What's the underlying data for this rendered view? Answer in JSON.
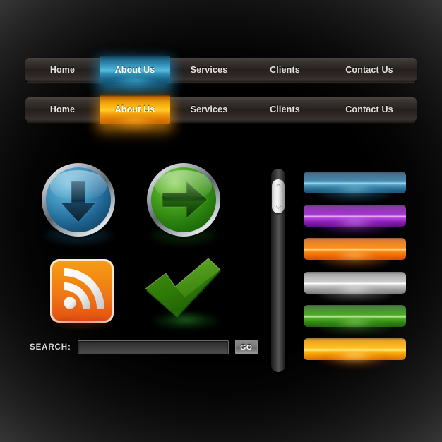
{
  "theme": {
    "background": "#000000",
    "vignette_edge": "#3b3b3b"
  },
  "navbars": [
    {
      "id": "navbar-blue",
      "accent": "#45a7cd",
      "active_index": 1,
      "items": [
        {
          "label": "Home"
        },
        {
          "label": "About Us"
        },
        {
          "label": "Services"
        },
        {
          "label": "Clients"
        },
        {
          "label": "Contact Us"
        }
      ]
    },
    {
      "id": "navbar-orange",
      "accent": "#fcb813",
      "active_index": 1,
      "items": [
        {
          "label": "Home"
        },
        {
          "label": "About Us"
        },
        {
          "label": "Services"
        },
        {
          "label": "Clients"
        },
        {
          "label": "Contact Us"
        }
      ]
    }
  ],
  "icons": {
    "download_button": {
      "name": "download-arrow-button",
      "icon": "arrow-down-icon",
      "color": "#3f92bd",
      "ring": "silver"
    },
    "forward_button": {
      "name": "forward-arrow-button",
      "icon": "arrow-right-icon",
      "color": "#2d8410",
      "ring": "silver"
    },
    "rss_button": {
      "name": "rss-feed-button",
      "icon": "rss-icon",
      "color": "#ee7616"
    },
    "check_button": {
      "name": "checkmark-button",
      "icon": "check-icon",
      "color": "#2d8410"
    }
  },
  "search": {
    "label": "SEARCH:",
    "value": "",
    "placeholder": "",
    "go_label": "GO"
  },
  "scrollbar": {
    "name": "vertical-scrollbar",
    "thumb_position_percent": 3,
    "up_icon": "chevron-up-icon",
    "down_icon": "chevron-down-icon"
  },
  "bar_buttons": [
    {
      "id": "bar-blue",
      "name": "blue-bar-button",
      "color": "#3f88ad"
    },
    {
      "id": "bar-purple",
      "name": "purple-bar-button",
      "color": "#a42ed2"
    },
    {
      "id": "bar-orange",
      "name": "orange-bar-button",
      "color": "#f98c13"
    },
    {
      "id": "bar-silver",
      "name": "silver-bar-button",
      "color": "#c9c9c9"
    },
    {
      "id": "bar-green",
      "name": "green-bar-button",
      "color": "#45a61d"
    },
    {
      "id": "bar-yellow",
      "name": "yellow-bar-button",
      "color": "#fdc015"
    }
  ]
}
